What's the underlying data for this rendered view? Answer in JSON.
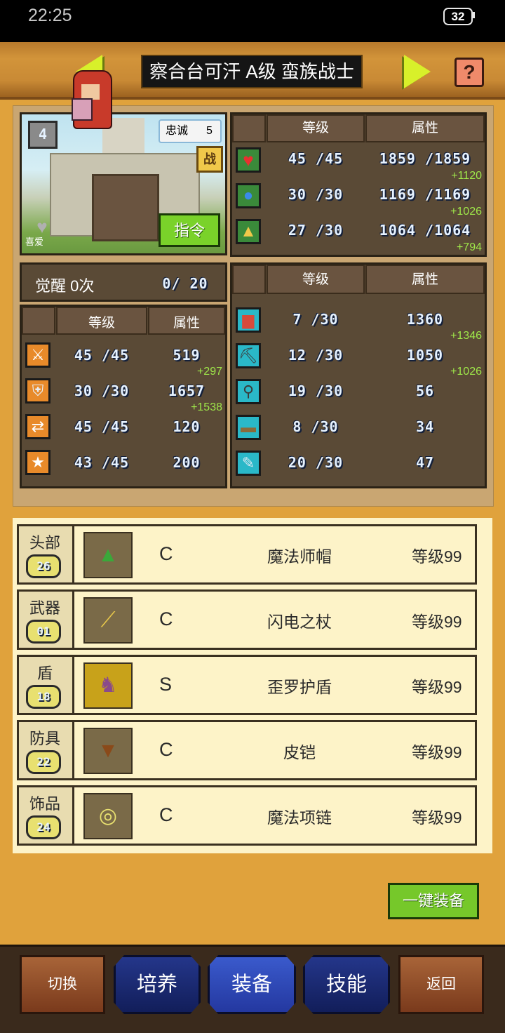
{
  "status_bar": {
    "time": "22:25",
    "battery": "32"
  },
  "header": {
    "title": "察合台可汗 A级 蛮族战士",
    "help_symbol": "?"
  },
  "portrait": {
    "loyalty_label": "忠诚",
    "loyalty_value": "5",
    "rank_badge": "4",
    "battle_symbol": "战",
    "command_button": "指令",
    "favorite_label": "喜爱"
  },
  "top_stats": {
    "headers": {
      "level": "等级",
      "attribute": "属性"
    },
    "rows": [
      {
        "icon": "heart-icon",
        "level": "45 /45",
        "value": "1859 /1859",
        "bonus": "+1120"
      },
      {
        "icon": "potion-icon",
        "level": "30 /30",
        "value": "1169 /1169",
        "bonus": "+1026"
      },
      {
        "icon": "arm-icon",
        "level": "27 /30",
        "value": "1064 /1064",
        "bonus": "+794"
      }
    ]
  },
  "awakening": {
    "label": "觉醒 0次",
    "progress": "0/ 20"
  },
  "left_stats": {
    "headers": {
      "level": "等级",
      "attribute": "属性"
    },
    "rows": [
      {
        "icon": "sword-icon",
        "level": "45 /45",
        "value": "519",
        "bonus": "+297"
      },
      {
        "icon": "shield-icon",
        "level": "30 /30",
        "value": "1657",
        "bonus": "+1538"
      },
      {
        "icon": "speed-icon",
        "level": "45 /45",
        "value": "120",
        "bonus": ""
      },
      {
        "icon": "star-icon",
        "level": "43 /45",
        "value": "200",
        "bonus": ""
      }
    ]
  },
  "right_stats": {
    "headers": {
      "level": "等级",
      "attribute": "属性"
    },
    "rows": [
      {
        "icon": "book-icon",
        "level": "7 /30",
        "value": "1360",
        "bonus": "+1346"
      },
      {
        "icon": "pickaxe-icon",
        "level": "12 /30",
        "value": "1050",
        "bonus": "+1026"
      },
      {
        "icon": "shovel-icon",
        "level": "19 /30",
        "value": "56",
        "bonus": ""
      },
      {
        "icon": "cart-icon",
        "level": "8 /30",
        "value": "34",
        "bonus": ""
      },
      {
        "icon": "scroll-icon",
        "level": "20 /30",
        "value": "47",
        "bonus": ""
      }
    ]
  },
  "equipment": [
    {
      "slot": "头部",
      "slot_level": "26",
      "grade": "C",
      "name": "魔法师帽",
      "level": "等级99",
      "icon": "wizard-hat-icon"
    },
    {
      "slot": "武器",
      "slot_level": "01",
      "grade": "C",
      "name": "闪电之杖",
      "level": "等级99",
      "icon": "staff-icon"
    },
    {
      "slot": "盾",
      "slot_level": "18",
      "grade": "S",
      "name": "歪罗护盾",
      "level": "等级99",
      "icon": "cat-shield-icon"
    },
    {
      "slot": "防具",
      "slot_level": "22",
      "grade": "C",
      "name": "皮铠",
      "level": "等级99",
      "icon": "leather-armor-icon"
    },
    {
      "slot": "饰品",
      "slot_level": "24",
      "grade": "C",
      "name": "魔法项链",
      "level": "等级99",
      "icon": "necklace-icon"
    }
  ],
  "one_key_equip": "一键装备",
  "nav": {
    "switch": "切换",
    "train": "培养",
    "equip": "装备",
    "skills": "技能",
    "back": "返回"
  },
  "colors": {
    "background": "#e0a23c",
    "bonus_text": "#9fe84a",
    "accent_green": "#76c82a",
    "nav_blue": "#24368a"
  }
}
